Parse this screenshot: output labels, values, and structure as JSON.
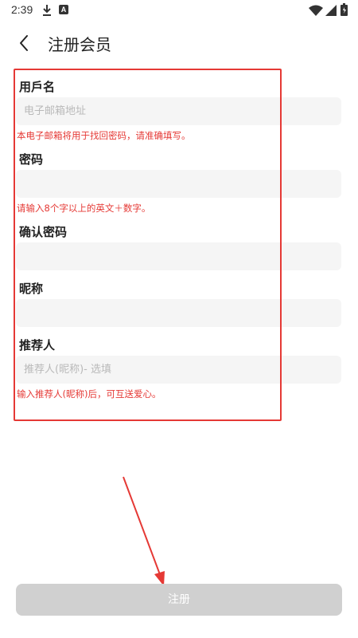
{
  "status_bar": {
    "time": "2:39",
    "a_label": "A",
    "icons": [
      "download-icon",
      "a-app-icon",
      "wifi-icon",
      "signal-icon",
      "battery-icon"
    ]
  },
  "header": {
    "title": "注册会员",
    "back_icon": "chevron-left-icon"
  },
  "form": {
    "username": {
      "label": "用戶名",
      "placeholder": "电子邮箱地址",
      "value": "",
      "hint": "本电子邮箱将用于找回密码，请准确填写。"
    },
    "password": {
      "label": "密码",
      "placeholder": "",
      "value": "",
      "hint": "请输入8个字以上的英文＋数字。"
    },
    "confirm_password": {
      "label": "确认密码",
      "placeholder": "",
      "value": ""
    },
    "nickname": {
      "label": "昵称",
      "placeholder": "",
      "value": ""
    },
    "referrer": {
      "label": "推荐人",
      "placeholder": "推荐人(昵称)- 选填",
      "value": "",
      "hint": "输入推荐人(昵称)后，可互送爱心。"
    }
  },
  "register_button": {
    "label": "注册"
  },
  "colors": {
    "hint_red": "#e53935",
    "annotation_red": "#e53935",
    "input_bg": "#f5f5f5",
    "button_disabled": "#d0d0d0"
  }
}
